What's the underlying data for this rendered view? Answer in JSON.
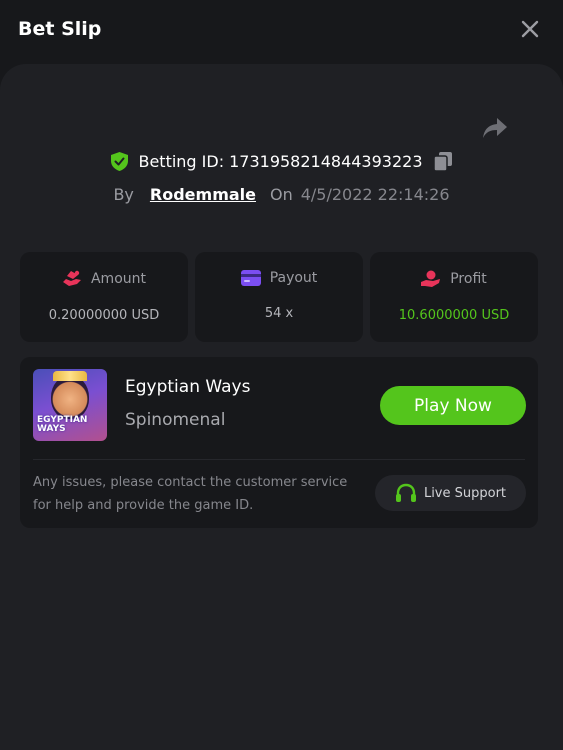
{
  "header": {
    "title": "Bet Slip",
    "close_icon": "close-icon"
  },
  "bet": {
    "id_label": "Betting ID:",
    "id_value": "1731958214844393223",
    "by_label": "By",
    "user": "Rodemmale",
    "on_label": "On",
    "datetime": "4/5/2022 22:14:26"
  },
  "stats": [
    {
      "label": "Amount",
      "value": "0.20000000 USD",
      "icon": "amount-icon",
      "color": "#e8345a"
    },
    {
      "label": "Payout",
      "value": "54 x",
      "icon": "payout-card-icon",
      "color": "#7b4ef2"
    },
    {
      "label": "Profit",
      "value": "10.6000000 USD",
      "icon": "profit-hand-icon",
      "color": "#e8345a",
      "value_color": "#54c51c"
    }
  ],
  "game": {
    "title": "Egyptian Ways",
    "provider": "Spinomenal",
    "thumb_text": "EGYPTIAN WAYS",
    "play_label": "Play Now"
  },
  "support": {
    "notice": "Any issues, please contact the customer service for help and provide the game ID.",
    "button_label": "Live Support",
    "icon": "headset-icon"
  },
  "colors": {
    "accent": "#54c51c",
    "background": "#17181b",
    "panel": "#1f2024"
  }
}
